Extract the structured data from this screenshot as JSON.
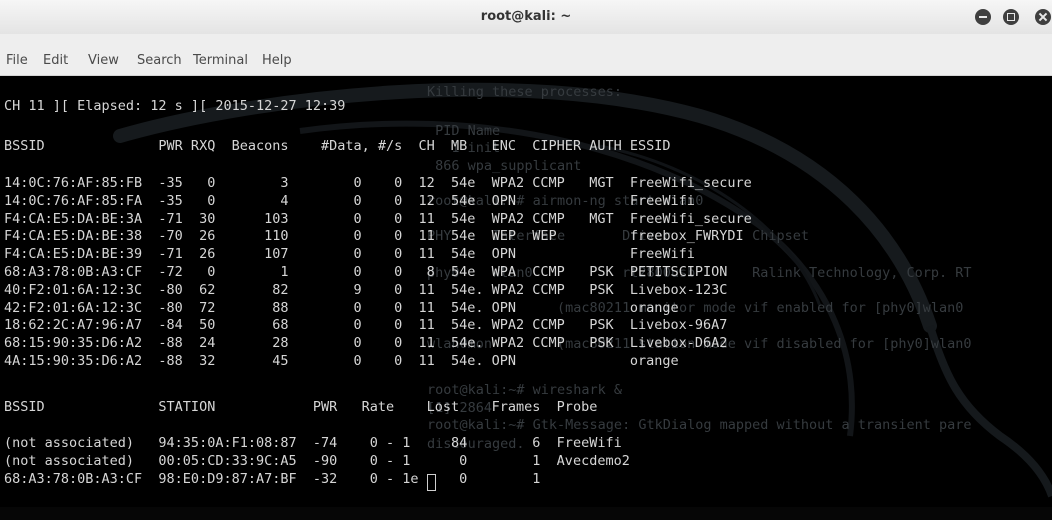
{
  "window": {
    "title": "root@kali: ~"
  },
  "menubar": {
    "items": [
      "File",
      "Edit",
      "View",
      "Search",
      "Terminal",
      "Help"
    ]
  },
  "background_output": [
    {
      "text": "Killing these processes:",
      "color": "dim"
    },
    {
      "text": " PID Name",
      "color": "dim"
    },
    {
      "text": "   1 init",
      "color": "dim"
    },
    {
      "text": " 866 wpa_supplicant",
      "color": "dim"
    },
    {
      "text": "root@kali:~# airmon-ng start wlan0",
      "color": "dim"
    },
    {
      "text": "PHY     Interface       Driver          Chipset",
      "color": "dim"
    },
    {
      "text": "phy0    wlan0           rt2800usb       Ralink Technology, Corp. RT",
      "color": "dim"
    },
    {
      "text": "                (mac80211 monitor mode vif enabled for [phy0]wlan0",
      "color": "dim"
    },
    {
      "text": "wlan0mon        (mac80211 station mode vif disabled for [phy0]wlan0",
      "color": "dim"
    },
    {
      "text": "root@kali:~# wireshark &",
      "color": "dim"
    },
    {
      "text": "[1] 2864",
      "color": "dim"
    },
    {
      "text": "root@kali:~# Gtk-Message: GtkDialog mapped without a transient pare",
      "color": "dim"
    },
    {
      "text": "discouraged.",
      "color": "dim"
    }
  ],
  "airodump": {
    "status_line": "CH 11 ][ Elapsed: 12 s ][ 2015-12-27 12:39",
    "ap_header": "BSSID              PWR RXQ  Beacons    #Data, #/s  CH  MB   ENC  CIPHER AUTH ESSID",
    "ap_rows": [
      "14:0C:76:AF:85:FB  -35   0        3        0    0  12  54e  WPA2 CCMP   MGT  FreeWifi_secure",
      "14:0C:76:AF:85:FA  -35   0        4        0    0  12  54e  OPN              FreeWifi",
      "F4:CA:E5:DA:BE:3A  -71  30      103        0    0  11  54e  WPA2 CCMP   MGT  FreeWifi_secure",
      "F4:CA:E5:DA:BE:38  -70  26      110        0    0  11  54e  WEP  WEP         freebox_FWRYDI",
      "F4:CA:E5:DA:BE:39  -71  26      107        0    0  11  54e  OPN              FreeWifi",
      "68:A3:78:0B:A3:CF  -72   0        1        0    0   8  54e  WPA  CCMP   PSK  PETITSCIPION",
      "40:F2:01:6A:12:3C  -80  62       82        9    0  11  54e. WPA2 CCMP   PSK  Livebox-123C",
      "42:F2:01:6A:12:3C  -80  72       88        0    0  11  54e. OPN              orange",
      "18:62:2C:A7:96:A7  -84  50       68        0    0  11  54e. WPA2 CCMP   PSK  Livebox-96A7",
      "68:15:90:35:D6:A2  -88  24       28        0    0  11  54e. WPA2 CCMP   PSK  Livebox-D6A2",
      "4A:15:90:35:D6:A2  -88  32       45        0    0  11  54e. OPN              orange"
    ],
    "station_header": "BSSID              STATION            PWR   Rate    Lost    Frames  Probe",
    "station_rows": [
      "(not associated)   94:35:0A:F1:08:87  -74    0 - 1     84        6  FreeWifi",
      "(not associated)   00:05:CD:33:9C:A5  -90    0 - 1      0        1  Avecdemo2",
      "68:A3:78:0B:A3:CF  98:E0:D9:87:A7:BF  -32    0 - 1e     0        1"
    ]
  },
  "colors": {
    "terminal_bg": "#000000",
    "terminal_fg": "#d6d6d6",
    "dim_text": "#363b3f",
    "titlebar": "#ececec"
  },
  "icons": [
    "minimize-icon",
    "maximize-icon",
    "close-icon",
    "kali-dragon-icon"
  ]
}
